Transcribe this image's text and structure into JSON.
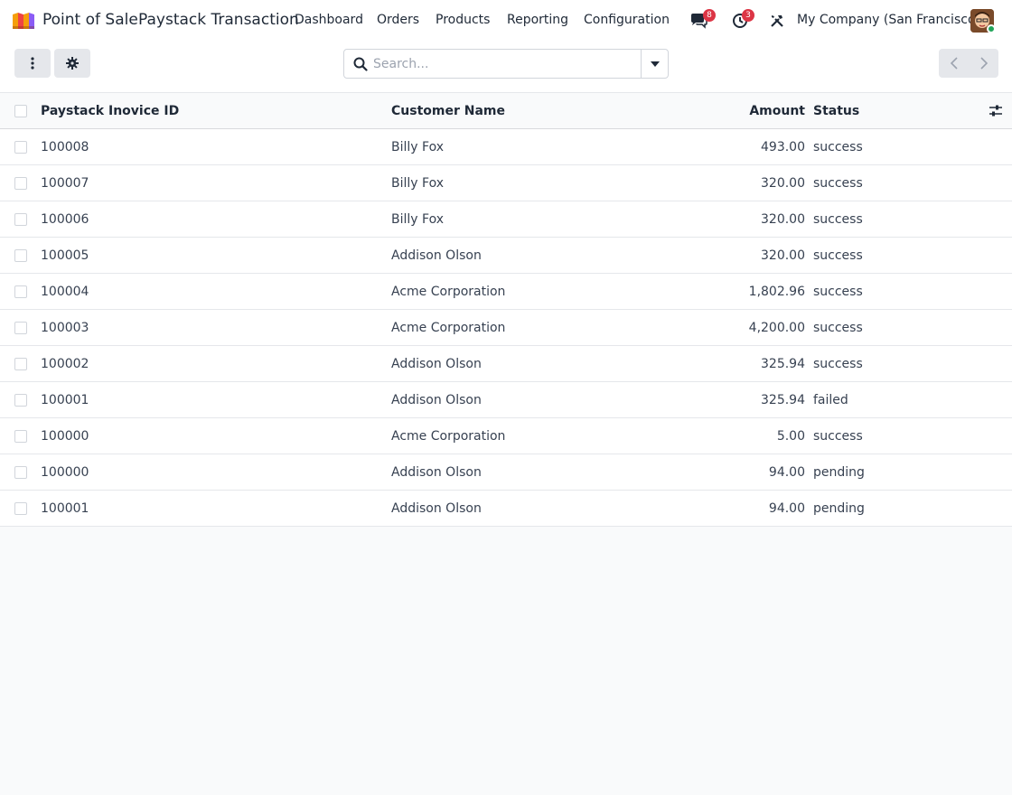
{
  "navbar": {
    "app_name": "Point of Sale",
    "breadcrumb": "Paystack Transaction",
    "menu": [
      "Dashboard",
      "Orders",
      "Products",
      "Reporting",
      "Configuration"
    ],
    "messages_count": "8",
    "activities_count": "3",
    "company": "My Company (San Francisco)"
  },
  "controls": {
    "search_placeholder": "Search..."
  },
  "table": {
    "columns": {
      "id": "Paystack Inovice ID",
      "customer": "Customer Name",
      "amount": "Amount",
      "status": "Status"
    },
    "rows": [
      {
        "id": "100008",
        "customer": "Billy Fox",
        "amount": "493.00",
        "status": "success"
      },
      {
        "id": "100007",
        "customer": "Billy Fox",
        "amount": "320.00",
        "status": "success"
      },
      {
        "id": "100006",
        "customer": "Billy Fox",
        "amount": "320.00",
        "status": "success"
      },
      {
        "id": "100005",
        "customer": "Addison Olson",
        "amount": "320.00",
        "status": "success"
      },
      {
        "id": "100004",
        "customer": "Acme Corporation",
        "amount": "1,802.96",
        "status": "success"
      },
      {
        "id": "100003",
        "customer": "Acme Corporation",
        "amount": "4,200.00",
        "status": "success"
      },
      {
        "id": "100002",
        "customer": "Addison Olson",
        "amount": "325.94",
        "status": "success"
      },
      {
        "id": "100001",
        "customer": "Addison Olson",
        "amount": "325.94",
        "status": "failed"
      },
      {
        "id": "100000",
        "customer": "Acme Corporation",
        "amount": "5.00",
        "status": "success"
      },
      {
        "id": "100000",
        "customer": "Addison Olson",
        "amount": "94.00",
        "status": "pending"
      },
      {
        "id": "100001",
        "customer": "Addison Olson",
        "amount": "94.00",
        "status": "pending"
      }
    ]
  },
  "colors": {
    "badge": "#dc3545",
    "presence": "#22a55a"
  }
}
